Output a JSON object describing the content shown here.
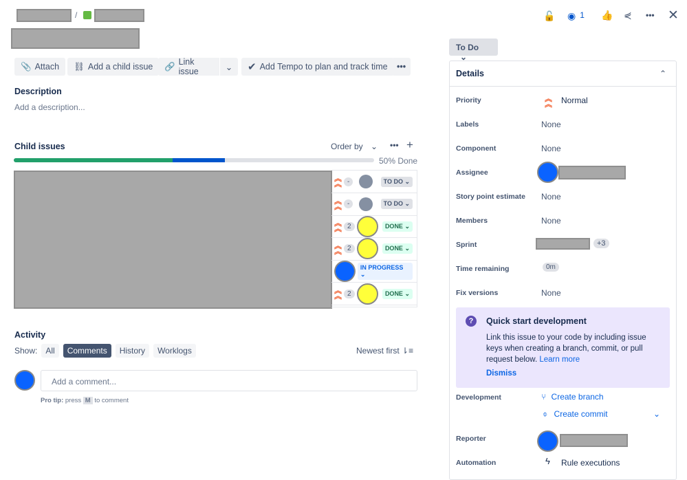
{
  "toolbar": {
    "attach": "Attach",
    "add_child": "Add a child issue",
    "link_issue": "Link issue",
    "tempo": "Add Tempo to plan and track time"
  },
  "breadcrumb_separator": "/",
  "description": {
    "heading": "Description",
    "placeholder": "Add a description..."
  },
  "child_issues": {
    "heading": "Child issues",
    "order_by": "Order by",
    "progress_text": "50% Done",
    "progress": {
      "done": 0.44,
      "in_progress": 0.146
    },
    "rows": [
      {
        "points": "-",
        "status": "TO DO",
        "kind": "todo",
        "avatar": "default"
      },
      {
        "points": "-",
        "status": "TO DO",
        "kind": "todo",
        "avatar": "default"
      },
      {
        "points": "2",
        "status": "DONE",
        "kind": "done",
        "avatar": "yellow"
      },
      {
        "points": "2",
        "status": "DONE",
        "kind": "done",
        "avatar": "yellow"
      },
      {
        "points": "",
        "status": "IN PROGRESS",
        "kind": "prog",
        "avatar": "blue"
      },
      {
        "points": "2",
        "status": "DONE",
        "kind": "done",
        "avatar": "yellow"
      }
    ]
  },
  "activity": {
    "heading": "Activity",
    "show": "Show:",
    "tabs": [
      "All",
      "Comments",
      "History",
      "Worklogs"
    ],
    "sort": "Newest first",
    "comment_placeholder": "Add a comment...",
    "pro_tip_bold": "Pro tip:",
    "pro_tip_press": "press",
    "pro_tip_key": "M",
    "pro_tip_end": "to comment"
  },
  "header": {
    "watchers": "1"
  },
  "status": "To Do",
  "details": {
    "title": "Details",
    "priority_label": "Priority",
    "priority": "Normal",
    "labels_label": "Labels",
    "labels": "None",
    "component_label": "Component",
    "component": "None",
    "assignee_label": "Assignee",
    "story_label": "Story point estimate",
    "story": "None",
    "members_label": "Members",
    "members": "None",
    "sprint_label": "Sprint",
    "sprint_more": "+3",
    "time_label": "Time remaining",
    "time": "0m",
    "fix_label": "Fix versions",
    "fix": "None",
    "quick": {
      "title": "Quick start development",
      "body": "Link this issue to your code by including issue keys when creating a branch, commit, or pull request below.",
      "learn": "Learn more",
      "dismiss": "Dismiss"
    },
    "dev_label": "Development",
    "create_branch": "Create branch",
    "create_commit": "Create commit",
    "reporter_label": "Reporter",
    "automation_label": "Automation",
    "rule": "Rule executions"
  },
  "colors": {
    "accent": "#0c66e4",
    "green": "#22a06b",
    "progress_blue": "#0055cc"
  }
}
